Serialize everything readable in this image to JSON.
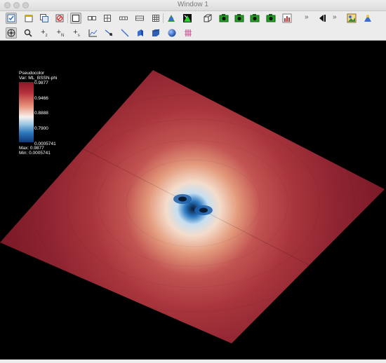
{
  "window": {
    "title": "Window 1"
  },
  "toolbar1": {
    "buttons": [
      {
        "name": "active-window-icon",
        "active": true
      },
      {
        "name": "new-window-icon"
      },
      {
        "name": "clone-window-icon"
      },
      {
        "name": "delete-window-icon"
      },
      {
        "name": "layout-1x1-icon",
        "active": true
      },
      {
        "name": "layout-1x2-icon"
      },
      {
        "name": "layout-2x2-icon"
      },
      {
        "name": "layout-1x3-icon"
      },
      {
        "name": "layout-3x3-icon"
      },
      {
        "name": "animation-icon"
      },
      {
        "name": "select-icon"
      },
      {
        "name": "bounding-box-icon"
      },
      {
        "name": "camera-icon"
      },
      {
        "name": "camera-icon-2"
      },
      {
        "name": "camera-icon-3"
      },
      {
        "name": "camera-icon-4"
      },
      {
        "name": "chart-icon"
      }
    ],
    "overflow": "»"
  },
  "toolbar2": {
    "buttons": [
      {
        "name": "navigate-icon",
        "active": true
      },
      {
        "name": "zoom-icon"
      },
      {
        "name": "zone-pick-icon",
        "glyph": "+",
        "sub": "z"
      },
      {
        "name": "node-pick-icon",
        "glyph": "+",
        "sub": "N"
      },
      {
        "name": "spreadsheet-pick-icon",
        "glyph": "+",
        "sub": "s"
      },
      {
        "name": "lineout-icon"
      },
      {
        "name": "line-tool-icon"
      },
      {
        "name": "line-icon"
      },
      {
        "name": "plane-icon"
      },
      {
        "name": "box-icon"
      },
      {
        "name": "sphere-icon"
      },
      {
        "name": "axis-array-icon"
      }
    ]
  },
  "toolbar1_right": {
    "overflow_left": "»",
    "overflow_right": "»"
  },
  "legend": {
    "title": "Pseudocolor",
    "var": "Var: ML_BSSN-phi",
    "ticks": [
      "0.9877",
      "0.9466",
      "0.8888",
      "0.7900",
      "0.0005741"
    ],
    "max": "Max: 0.9877",
    "min": "Min: 0.0005741"
  },
  "colors": {
    "plane_outer": "#6e1220",
    "plane_mid": "#b03a40",
    "plane_light": "#f4d8c4",
    "center_blue": "#1b6fb8",
    "core": "#06172e"
  }
}
